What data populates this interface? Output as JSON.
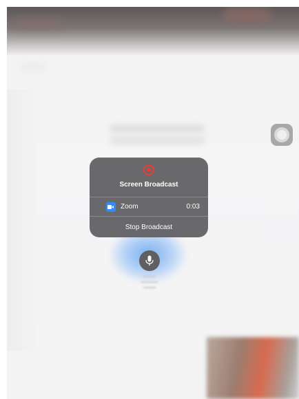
{
  "popup": {
    "title": "Screen Broadcast",
    "record_icon": "record-icon",
    "app": {
      "name": "Zoom",
      "icon": "zoom-icon",
      "elapsed": "0:03"
    },
    "stop_label": "Stop Broadcast"
  },
  "mic": {
    "icon": "microphone-icon"
  },
  "assistive_touch": {
    "icon": "assistive-touch-icon"
  },
  "colors": {
    "record_red": "#ec3b35",
    "zoom_blue": "#2d8cff",
    "popup_bg": "#5e5e61"
  }
}
